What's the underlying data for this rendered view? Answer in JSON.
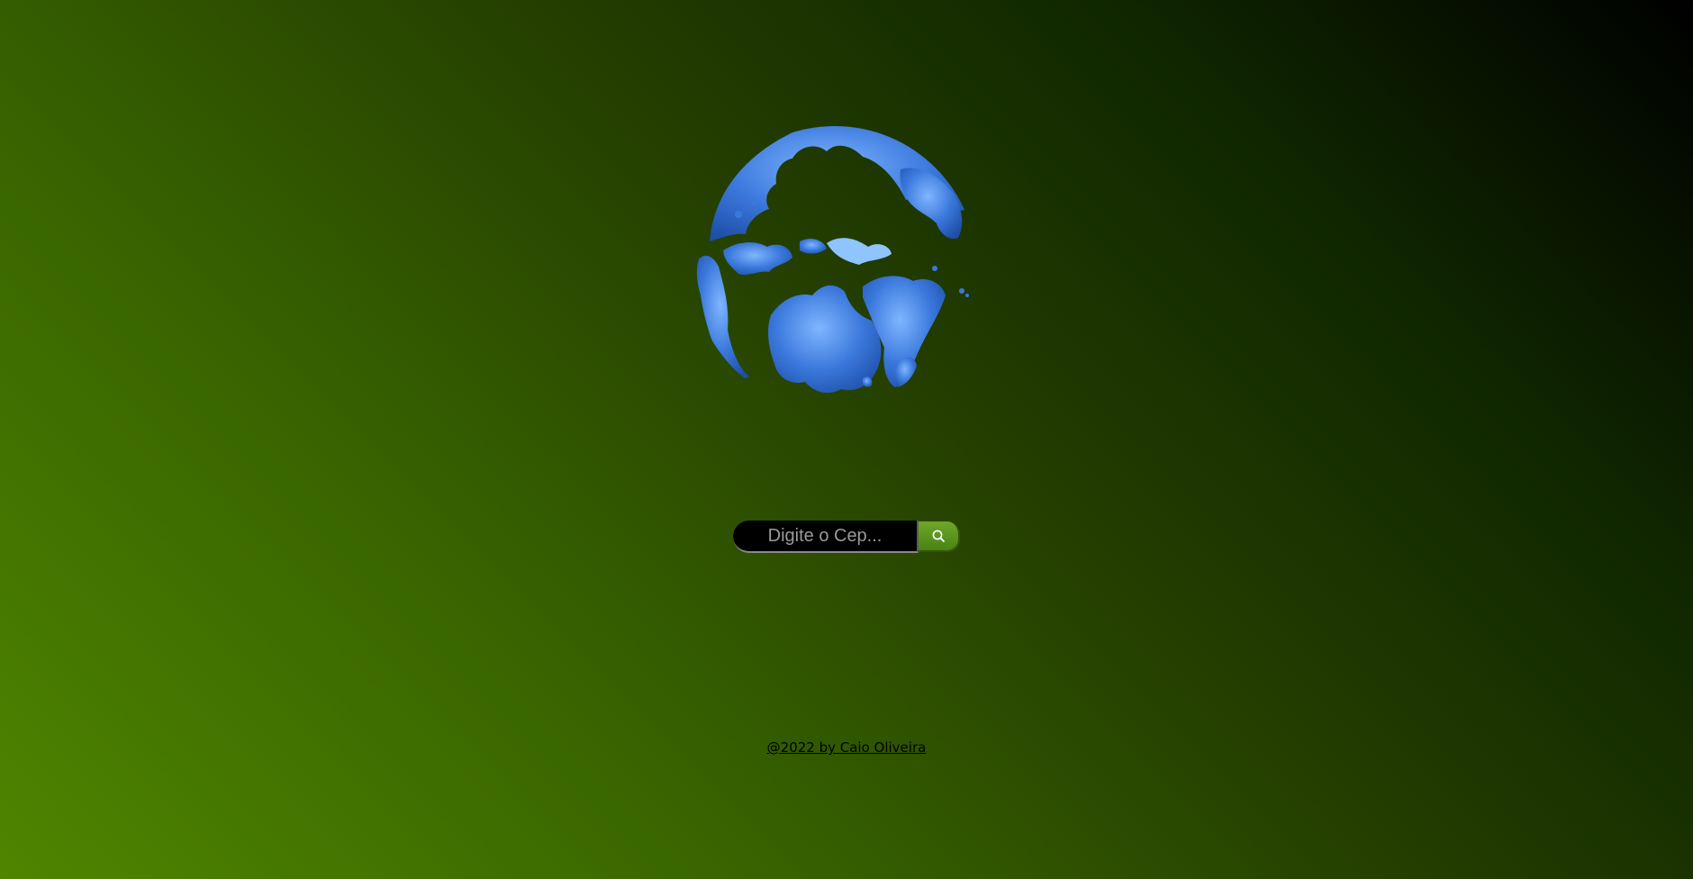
{
  "search": {
    "placeholder": "Digite o Cep...",
    "value": "",
    "button_icon": "search-icon"
  },
  "footer": {
    "credit_text": "@2022 by Caio Oliveira"
  },
  "globe": {
    "icon": "globe-icon",
    "ocean_color": "#0b1a00",
    "land_color": "#3a78d8"
  },
  "colors": {
    "background_dark": "#000000",
    "background_light": "#4f8500",
    "button_green": "#5a9420"
  }
}
